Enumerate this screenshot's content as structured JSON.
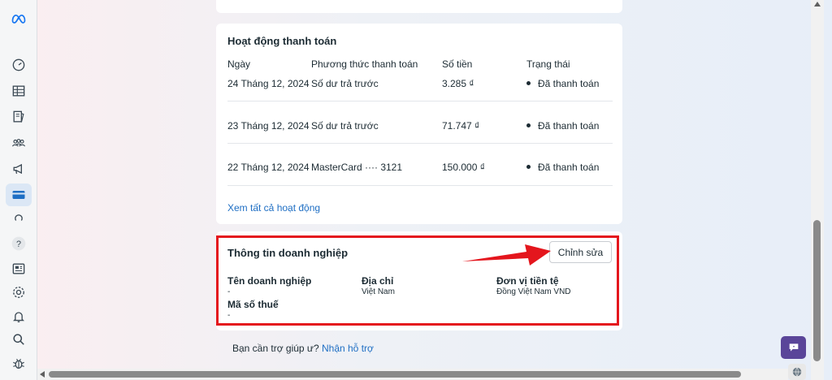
{
  "sidebar": {
    "items": [
      {
        "icon": "meta-logo-icon"
      },
      {
        "icon": "dashboard-icon"
      },
      {
        "icon": "table-icon"
      },
      {
        "icon": "catalog-icon"
      },
      {
        "icon": "people-icon"
      },
      {
        "icon": "megaphone-icon"
      },
      {
        "icon": "billing-card-icon",
        "active": true
      },
      {
        "icon": "loading-icon"
      },
      {
        "icon": "help-icon"
      },
      {
        "icon": "news-icon"
      },
      {
        "icon": "settings-icon"
      },
      {
        "icon": "bell-icon"
      },
      {
        "icon": "search-icon"
      },
      {
        "icon": "bug-icon"
      }
    ]
  },
  "payment_activity": {
    "title": "Hoạt động thanh toán",
    "columns": [
      "Ngày",
      "Phương thức thanh toán",
      "Số tiền",
      "Trạng thái"
    ],
    "rows": [
      {
        "date": "24 Tháng 12, 2024",
        "method": "Số dư trả trước",
        "amount": "3.285 ₫",
        "status": "Đã thanh toán"
      },
      {
        "date": "23 Tháng 12, 2024",
        "method": "Số dư trả trước",
        "amount": "71.747 ₫",
        "status": "Đã thanh toán"
      },
      {
        "date": "22 Tháng 12, 2024",
        "method": "MasterCard ···· 3121",
        "amount": "150.000 ₫",
        "status": "Đã thanh toán"
      }
    ],
    "view_all": "Xem tất cả hoạt động"
  },
  "business_info": {
    "title": "Thông tin doanh nghiệp",
    "edit_label": "Chỉnh sửa",
    "business_name_label": "Tên doanh nghiệp",
    "business_name_value": "-",
    "address_label": "Địa chỉ",
    "address_value": "Việt Nam",
    "currency_label": "Đơn vị tiền tệ",
    "currency_value": "Đồng Việt Nam VND",
    "tax_label": "Mã số thuế",
    "tax_value": "-"
  },
  "footer": {
    "help_text": "Bạn cần trợ giúp ư?",
    "help_link": "Nhận hỗ trợ"
  },
  "colors": {
    "highlight": "#e4161d",
    "link": "#1f6fc4",
    "chat_button": "#5a4599"
  }
}
